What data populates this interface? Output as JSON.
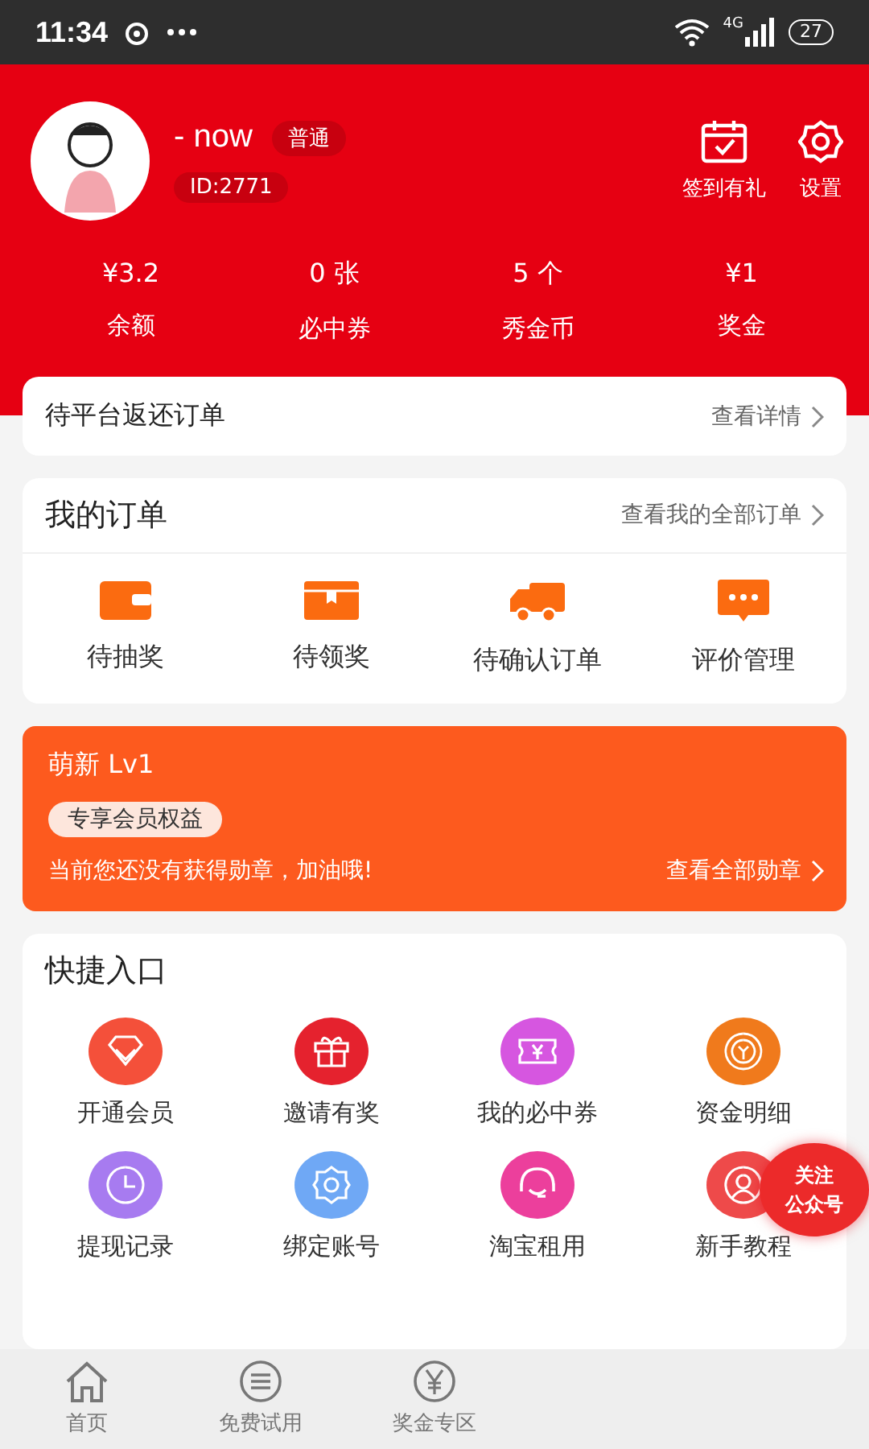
{
  "status_bar": {
    "time": "11:34",
    "battery": "27",
    "network": "4G"
  },
  "profile": {
    "name": "- now",
    "level_badge": "普通",
    "id": "ID:2771",
    "actions": [
      {
        "label": "签到有礼"
      },
      {
        "label": "设置"
      }
    ]
  },
  "stats": [
    {
      "value": "¥3.2",
      "label": "余额"
    },
    {
      "value": "0 张",
      "label": "必中券"
    },
    {
      "value": "5 个",
      "label": "秀金币"
    },
    {
      "value": "¥1",
      "label": "奖金"
    }
  ],
  "pending_return": {
    "title": "待平台返还订单",
    "link": "查看详情"
  },
  "orders": {
    "title": "我的订单",
    "link": "查看我的全部订单",
    "items": [
      {
        "label": "待抽奖"
      },
      {
        "label": "待领奖"
      },
      {
        "label": "待确认订单"
      },
      {
        "label": "评价管理"
      }
    ]
  },
  "membership": {
    "level": "萌新 Lv1",
    "benefits": "专享会员权益",
    "message": "当前您还没有获得勋章，加油哦!",
    "link": "查看全部勋章"
  },
  "shortcuts": {
    "title": "快捷入口",
    "items": [
      {
        "label": "开通会员",
        "color": "#f4503a"
      },
      {
        "label": "邀请有奖",
        "color": "#e5222e"
      },
      {
        "label": "我的必中券",
        "color": "#d656e0"
      },
      {
        "label": "资金明细",
        "color": "#f07a1c"
      },
      {
        "label": "提现记录",
        "color": "#a77bf0"
      },
      {
        "label": "绑定账号",
        "color": "#6fa8f5"
      },
      {
        "label": "淘宝租用",
        "color": "#ec3f9c"
      },
      {
        "label": "新手教程",
        "color": "#ee4a4a"
      }
    ]
  },
  "follow_badge": {
    "lines": [
      "关注",
      "公众号"
    ]
  },
  "bottom_nav": [
    {
      "label": "首页",
      "selected": false
    },
    {
      "label": "免费试用",
      "selected": false
    },
    {
      "label": "奖金专区",
      "selected": false
    }
  ]
}
